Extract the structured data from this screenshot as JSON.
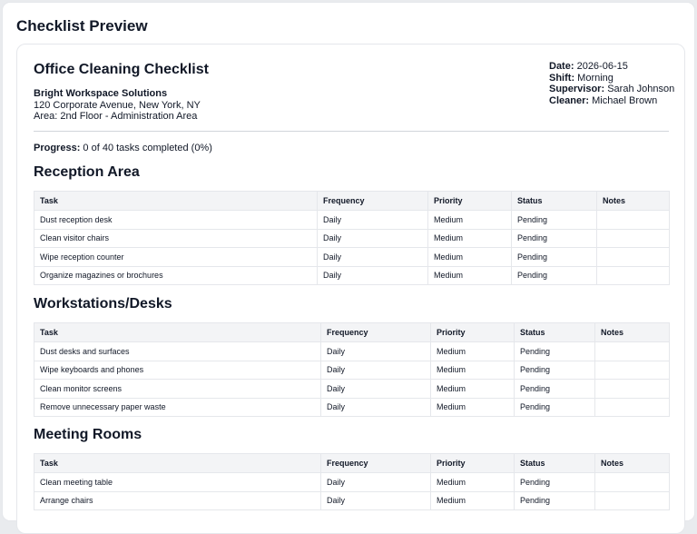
{
  "preview_title": "Checklist Preview",
  "checklist": {
    "title": "Office Cleaning Checklist",
    "company": "Bright Workspace Solutions",
    "address": "120 Corporate Avenue, New York, NY",
    "area": "Area: 2nd Floor - Administration Area"
  },
  "meta": {
    "date_label": "Date:",
    "date": "2026-06-15",
    "shift_label": "Shift:",
    "shift": "Morning",
    "supervisor_label": "Supervisor:",
    "supervisor": "Sarah Johnson",
    "cleaner_label": "Cleaner:",
    "cleaner": "Michael Brown"
  },
  "progress": {
    "label": "Progress:",
    "text": "0 of 40 tasks completed (0%)",
    "completed": 0,
    "total": 40
  },
  "columns": [
    "Task",
    "Frequency",
    "Priority",
    "Status",
    "Notes"
  ],
  "sections": [
    {
      "title": "Reception Area",
      "rows": [
        [
          "Dust reception desk",
          "Daily",
          "Medium",
          "Pending",
          ""
        ],
        [
          "Clean visitor chairs",
          "Daily",
          "Medium",
          "Pending",
          ""
        ],
        [
          "Wipe reception counter",
          "Daily",
          "Medium",
          "Pending",
          ""
        ],
        [
          "Organize magazines or brochures",
          "Daily",
          "Medium",
          "Pending",
          ""
        ]
      ]
    },
    {
      "title": "Workstations/Desks",
      "rows": [
        [
          "Dust desks and surfaces",
          "Daily",
          "Medium",
          "Pending",
          ""
        ],
        [
          "Wipe keyboards and phones",
          "Daily",
          "Medium",
          "Pending",
          ""
        ],
        [
          "Clean monitor screens",
          "Daily",
          "Medium",
          "Pending",
          ""
        ],
        [
          "Remove unnecessary paper waste",
          "Daily",
          "Medium",
          "Pending",
          ""
        ]
      ]
    },
    {
      "title": "Meeting Rooms",
      "rows": [
        [
          "Clean meeting table",
          "Daily",
          "Medium",
          "Pending",
          ""
        ],
        [
          "Arrange chairs",
          "Daily",
          "Medium",
          "Pending",
          ""
        ]
      ]
    }
  ]
}
